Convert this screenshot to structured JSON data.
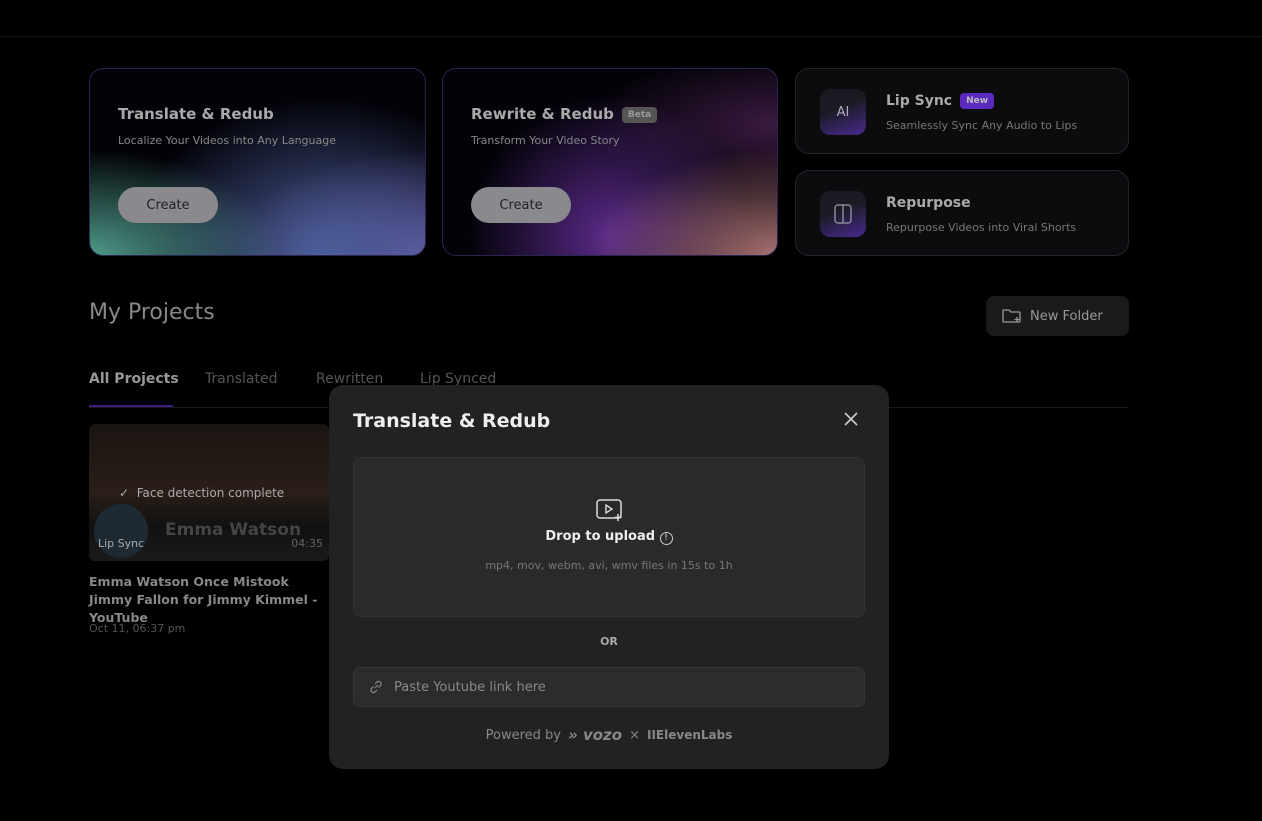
{
  "cards": {
    "translate": {
      "title": "Translate & Redub",
      "subtitle": "Localize Your Videos into Any Language",
      "button": "Create"
    },
    "rewrite": {
      "title": "Rewrite & Redub",
      "badge": "Beta",
      "subtitle": "Transform Your Video Story",
      "button": "Create"
    },
    "lipsync": {
      "title": "Lip Sync",
      "badge": "New",
      "subtitle": "Seamlessly Sync Any Audio to Lips",
      "icon_text": "AI"
    },
    "repurpose": {
      "title": "Repurpose",
      "subtitle": "Repurpose Videos into Viral Shorts"
    }
  },
  "projects": {
    "title": "My Projects",
    "new_folder": "New Folder",
    "tabs": [
      "All Projects",
      "Translated",
      "Rewritten",
      "Lip Synced"
    ],
    "items": [
      {
        "status": "Face detection complete",
        "overlay_name": "Emma Watson",
        "type": "Lip Sync",
        "duration": "04:35",
        "title": "Emma Watson Once Mistook Jimmy Fallon for Jimmy Kimmel - YouTube",
        "date": "Oct 11, 06:37 pm"
      }
    ]
  },
  "modal": {
    "title": "Translate & Redub",
    "drop_label": "Drop to upload",
    "formats": "mp4, mov, webm, avi, wmv files in 15s to 1h",
    "or": "OR",
    "link_placeholder": "Paste Youtube link here",
    "powered_by": "Powered by",
    "brand1": "vozo",
    "times": "×",
    "brand2": "IIElevenLabs"
  },
  "colors": {
    "accent": "#5b2bc0",
    "background": "#000000",
    "modal": "#222222"
  }
}
